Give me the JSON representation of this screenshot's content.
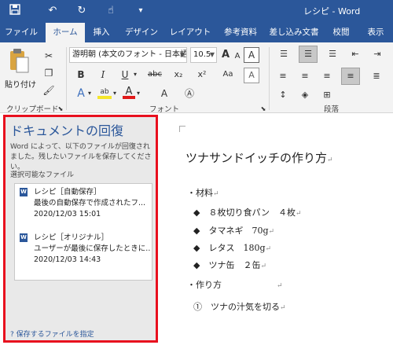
{
  "window": {
    "title": "レシピ - Word"
  },
  "tabs": [
    {
      "label": "ファイル",
      "active": false
    },
    {
      "label": "ホーム",
      "active": true
    },
    {
      "label": "挿入",
      "active": false
    },
    {
      "label": "デザイン",
      "active": false
    },
    {
      "label": "レイアウト",
      "active": false
    },
    {
      "label": "参考資料",
      "active": false
    },
    {
      "label": "差し込み文書",
      "active": false
    },
    {
      "label": "校閲",
      "active": false
    },
    {
      "label": "表示",
      "active": false
    }
  ],
  "ribbon": {
    "paste_label": "貼り付け",
    "clipboard_group": "クリップボード",
    "font_group": "フォント",
    "paragraph_group": "段落",
    "font_name": "游明朝 (本文のフォント - 日本語)",
    "font_size": "10.5",
    "btn_bold": "B",
    "btn_italic": "I",
    "btn_underline": "U",
    "btn_strike": "abc",
    "btn_sub": "x₂",
    "btn_sup": "x²",
    "btn_fontcolor": "A",
    "btn_texteffect": "A",
    "btn_highlight": "ab",
    "btn_clear": "A",
    "btn_grow": "A",
    "btn_shrink": "A",
    "btn_case": "Aa"
  },
  "recovery": {
    "title": "ドキュメントの回復",
    "description": "Word によって、以下のファイルが回復されました。残したいファイルを保存してください。",
    "available_label": "選択可能なファイル",
    "files": [
      {
        "name": "レシピ［自動保存］",
        "desc": "最後の自動保存で作成されたフ...",
        "time": "2020/12/03 15:01"
      },
      {
        "name": "レシピ［オリジナル］",
        "desc": "ユーザーが最後に保存したときに...",
        "time": "2020/12/03 14:43"
      }
    ],
    "footer": "保存するファイルを指定"
  },
  "document": {
    "title": "ツナサンドイッチの作り方",
    "heading_materials": "・材料",
    "ingredients": [
      "◆　８枚切り食パン　４枚",
      "◆　タマネギ　70g",
      "◆　レタス　180g",
      "◆　ツナ缶　２缶"
    ],
    "heading_steps": "・作り方",
    "steps": [
      "①　ツナの汁気を切る"
    ],
    "para_mark": "↵"
  },
  "colors": {
    "accent": "#2b579a",
    "highlight_border": "#e8101e"
  }
}
